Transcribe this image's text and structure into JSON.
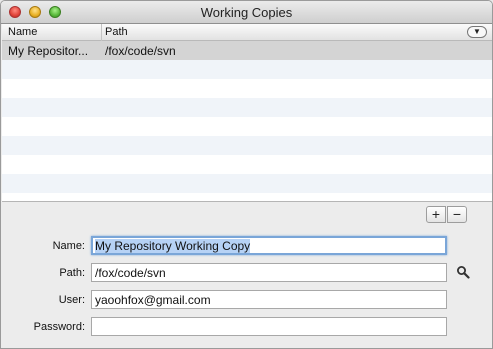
{
  "window": {
    "title": "Working Copies"
  },
  "table": {
    "columns": [
      "Name",
      "Path"
    ],
    "column_menu_glyph": "▼",
    "rows": [
      {
        "name": "My Repositor...",
        "path": "/fox/code/svn"
      }
    ]
  },
  "buttons": {
    "add": "+",
    "remove": "−"
  },
  "form": {
    "name_label": "Name:",
    "name_value": "My Repository Working Copy",
    "path_label": "Path:",
    "path_value": "/fox/code/svn",
    "user_label": "User:",
    "user_value": "yaoohfox@gmail.com",
    "password_label": "Password:",
    "password_value": ""
  },
  "icons": {
    "browse_path": "magnifier-icon"
  }
}
